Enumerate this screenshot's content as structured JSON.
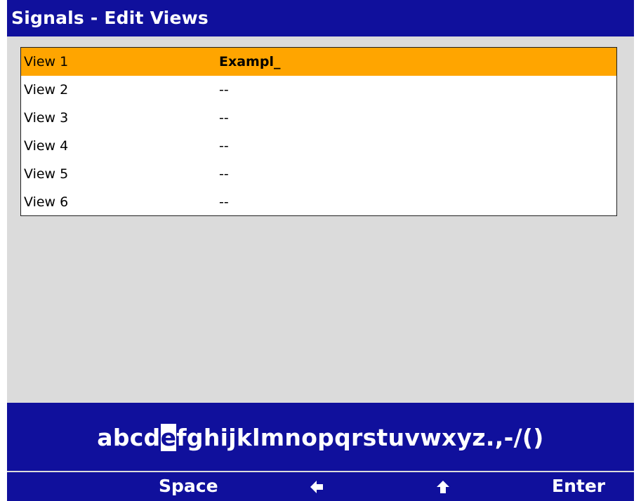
{
  "header": {
    "title": "Signals - Edit Views"
  },
  "views": [
    {
      "name": "View 1",
      "value": "Exampl_",
      "selected": true
    },
    {
      "name": "View 2",
      "value": "--",
      "selected": false
    },
    {
      "name": "View 3",
      "value": "--",
      "selected": false
    },
    {
      "name": "View 4",
      "value": "--",
      "selected": false
    },
    {
      "name": "View 5",
      "value": "--",
      "selected": false
    },
    {
      "name": "View 6",
      "value": "--",
      "selected": false
    }
  ],
  "keyboard": {
    "before": "abcd",
    "highlighted": "e",
    "after": "fghijklmnopqrstuvwxyz.,-/()"
  },
  "softkeys": {
    "space_label": "Space",
    "backspace_icon": "left-arrow-icon",
    "shift_icon": "up-arrow-icon",
    "enter_label": "Enter"
  },
  "colors": {
    "bar": "#10109c",
    "selection": "#ffa500",
    "background": "#dbdbdb"
  }
}
